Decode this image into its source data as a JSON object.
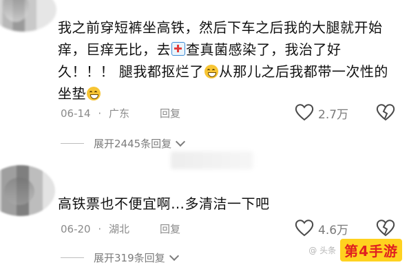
{
  "comments": [
    {
      "lines": [
        [
          "我之前穿短裤坐高铁，然后下车之后我的大腿就开始"
        ],
        [
          "痒，巨痒无比，去",
          "查真菌感染了，我治了好"
        ],
        [
          "久！！！ 腿我都抠烂了",
          "从那儿之后我都带一次性的"
        ],
        [
          "坐垫"
        ]
      ],
      "date": "06-14",
      "location": "广东",
      "reply_label": "回复",
      "like_count": "2.7万",
      "expand_label": "展开2445条回复"
    },
    {
      "text": "高铁票也不便宜啊…多清洁一下吧",
      "date": "06-20",
      "location": "湖北",
      "reply_label": "回复",
      "like_count": "4.6万",
      "expand_label": "展开319条回复"
    }
  ],
  "watermark": {
    "small": "@ 头条",
    "brand": "第4手游"
  },
  "icons": [
    "heart-icon",
    "broken-heart-icon",
    "chevron-down-icon",
    "hospital-emoji-icon",
    "grin-sweat-emoji-icon"
  ]
}
